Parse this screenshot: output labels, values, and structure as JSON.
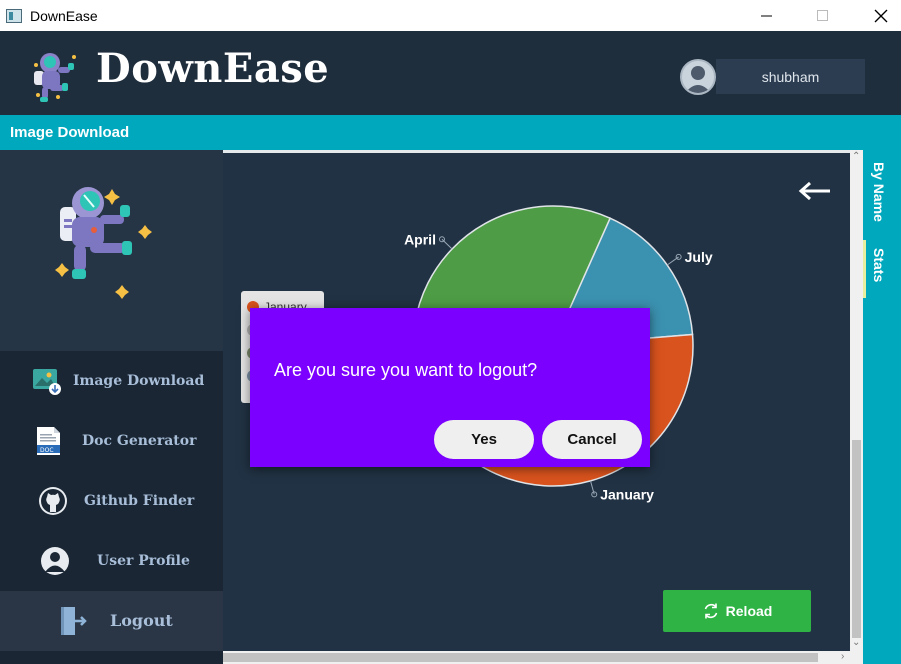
{
  "window": {
    "title": "DownEase"
  },
  "header": {
    "brand": "DownEase",
    "username": "shubham"
  },
  "section": {
    "title": "Image Download"
  },
  "sidebar": {
    "items": [
      {
        "label": "Image Download",
        "icon": "image-download-icon"
      },
      {
        "label": "Doc   Generator",
        "icon": "doc-icon"
      },
      {
        "label": "Github  Finder",
        "icon": "github-icon"
      },
      {
        "label": "User  Profile",
        "icon": "user-icon"
      },
      {
        "label": "Logout",
        "icon": "logout-icon"
      }
    ]
  },
  "tabs": {
    "by_name": "By Name",
    "stats": "Stats"
  },
  "chart_data": {
    "type": "pie",
    "slices": [
      {
        "label": "July",
        "value": 17,
        "color": "#3b91b0"
      },
      {
        "label": "January",
        "value": 44,
        "color": "#d9531e"
      },
      {
        "label": "April",
        "value": 39,
        "color": "#4e9c46"
      }
    ],
    "legend_visible": [
      "January"
    ],
    "legend_placement": "left"
  },
  "reload": {
    "label": "Reload"
  },
  "dialog": {
    "message": "Are you sure you want to logout?",
    "yes_label": "Yes",
    "cancel_label": "Cancel"
  }
}
